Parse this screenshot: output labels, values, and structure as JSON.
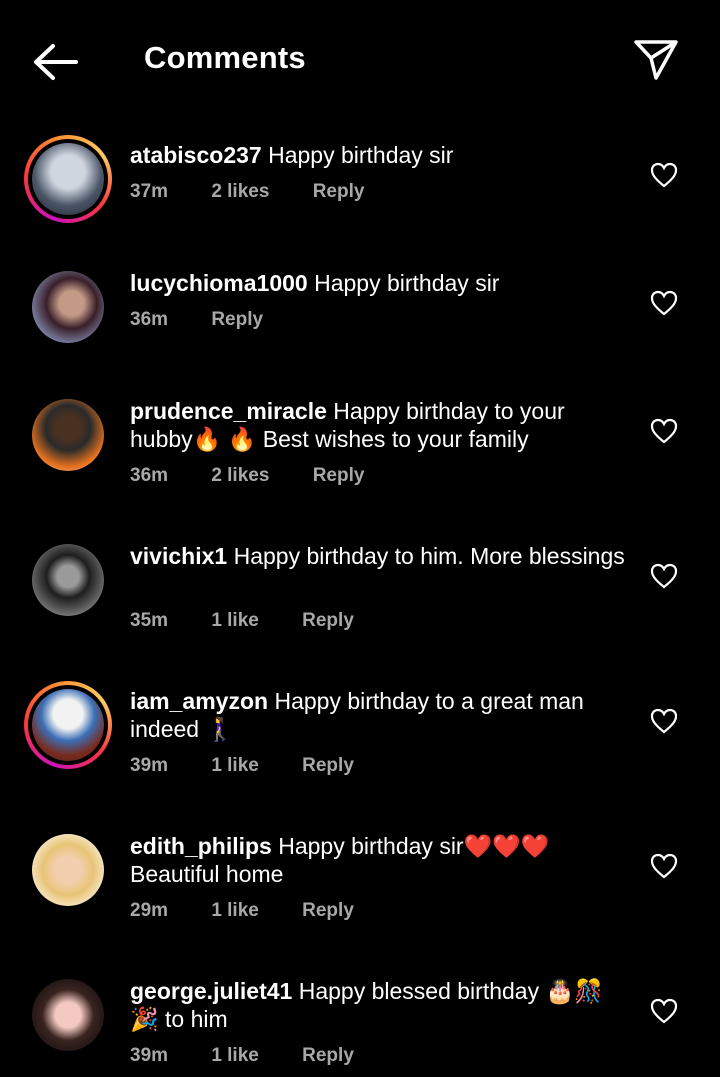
{
  "header": {
    "title": "Comments"
  },
  "comments": [
    {
      "username": "atabisco237",
      "text": "Happy birthday sir",
      "time": "37m",
      "likes": "2 likes",
      "reply": "Reply",
      "ring": true
    },
    {
      "username": "lucychioma1000",
      "text": "Happy birthday sir",
      "time": "36m",
      "likes": "",
      "reply": "Reply",
      "ring": false
    },
    {
      "username": "prudence_miracle",
      "text": "Happy birthday to your hubby🔥 🔥 Best wishes to your family",
      "time": "36m",
      "likes": "2 likes",
      "reply": "Reply",
      "ring": false
    },
    {
      "username": "vivichix1",
      "text": "Happy birthday to him. More blessings",
      "time": "35m",
      "likes": "1 like",
      "reply": "Reply",
      "ring": false
    },
    {
      "username": "iam_amyzon",
      "text": "Happy birthday to a great man indeed 🚶‍♀️",
      "time": "39m",
      "likes": "1 like",
      "reply": "Reply",
      "ring": true
    },
    {
      "username": "edith_philips",
      "text": "Happy birthday sir❤️❤️❤️ Beautiful home",
      "time": "29m",
      "likes": "1 like",
      "reply": "Reply",
      "ring": false
    },
    {
      "username": "george.juliet41",
      "text": "Happy blessed birthday 🎂🎊🎉 to him",
      "time": "39m",
      "likes": "1 like",
      "reply": "Reply",
      "ring": false
    }
  ]
}
